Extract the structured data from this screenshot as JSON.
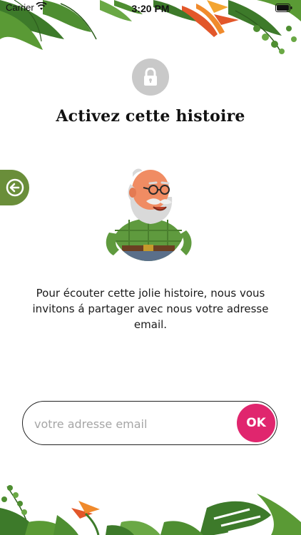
{
  "status_bar": {
    "carrier": "Carrier",
    "time": "3:20 PM",
    "wifi_icon": "wifi-icon",
    "battery_icon": "battery-icon"
  },
  "lock_icon": "lock-icon",
  "title": "Activez cette histoire",
  "back_icon": "arrow-left-icon",
  "message": "Pour écouter cette jolie histoire, nous vous invitons á partager avec nous votre adresse email.",
  "email": {
    "value": "",
    "placeholder": "votre adresse email"
  },
  "ok_label": "OK",
  "colors": {
    "accent_pink": "#e0266e",
    "back_tab_green": "#6a8e3a",
    "lock_gray": "#c9c9c9"
  }
}
